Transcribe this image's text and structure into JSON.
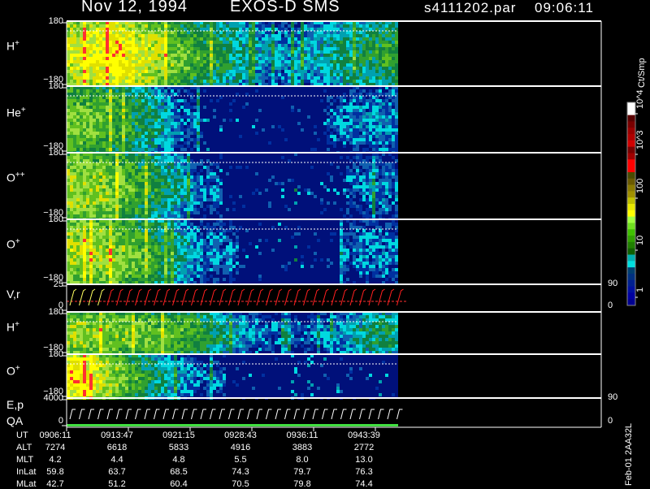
{
  "header": {
    "date": "Nov 12, 1994",
    "instrument": "EXOS-D SMS",
    "file": "s4111202.par",
    "time": "09:06:11"
  },
  "colorbar": {
    "unit": "Ct/Smp",
    "ticks": [
      "10^4",
      "10^3",
      "100",
      "10",
      "1"
    ],
    "colors": [
      "#ffffff",
      "#ffffff",
      "#5a0000",
      "#7a0000",
      "#9a0000",
      "#b00000",
      "#d00000",
      "#7a0000",
      "#a00000",
      "#ff0000",
      "#ff0000",
      "#4a4a00",
      "#6a5a00",
      "#8a7a00",
      "#a09000",
      "#c0c000",
      "#e8e800",
      "#ffff00",
      "#a0ff40",
      "#70e020",
      "#40c000",
      "#30a000",
      "#208000",
      "#106000",
      "#00b0b0",
      "#00e0e0",
      "#004070",
      "#003080",
      "#002090",
      "#0010a0",
      "#0000a0",
      "#000090"
    ]
  },
  "panels": [
    {
      "id": "h-plus",
      "label": "H",
      "sup": "+",
      "top_tick": "180",
      "bot_tick": "−180"
    },
    {
      "id": "he-plus",
      "label": "He",
      "sup": "+",
      "top_tick": "180",
      "bot_tick": "−180"
    },
    {
      "id": "o-plusplus",
      "label": "O",
      "sup": "++",
      "top_tick": "180",
      "bot_tick": "−180"
    },
    {
      "id": "o-plus",
      "label": "O",
      "sup": "+",
      "top_tick": "180",
      "bot_tick": "−180"
    },
    {
      "id": "vr",
      "label": "V,r",
      "sup": "",
      "top_tick": "25",
      "bot_tick": "0",
      "right_top": "90",
      "right_bot": "0"
    },
    {
      "id": "h-plus-2",
      "label": "H",
      "sup": "+",
      "top_tick": "180",
      "bot_tick": "−180"
    },
    {
      "id": "o-plus-2",
      "label": "O",
      "sup": "+",
      "top_tick": "180",
      "bot_tick": "−180"
    },
    {
      "id": "ep",
      "label": "E,p",
      "label2": "QA",
      "sup": "",
      "top_tick": "4000",
      "bot_tick": "0",
      "right_top": "90",
      "right_bot": "0"
    }
  ],
  "footer": {
    "rows": [
      {
        "name": "UT",
        "values": [
          "0906:11",
          "0913:47",
          "0921:15",
          "0928:43",
          "0936:11",
          "0943:39"
        ]
      },
      {
        "name": "ALT",
        "values": [
          "7274",
          "6618",
          "5833",
          "4916",
          "3883",
          "2772"
        ]
      },
      {
        "name": "MLT",
        "values": [
          "4.2",
          "4.4",
          "4.8",
          "5.5",
          "8.0",
          "13.0"
        ]
      },
      {
        "name": "InLat",
        "values": [
          "59.8",
          "63.7",
          "68.5",
          "74.3",
          "79.7",
          "76.3"
        ]
      },
      {
        "name": "MLat",
        "values": [
          "42.7",
          "51.2",
          "60.4",
          "70.5",
          "79.8",
          "74.4"
        ]
      }
    ],
    "side_note": "Feb-01 2AA32L"
  },
  "chart_data": {
    "type": "heatmap",
    "x_time_labels": [
      "0906:11",
      "0913:47",
      "0921:15",
      "0928:43",
      "0936:11",
      "0943:39"
    ],
    "panels": [
      {
        "id": "h-plus",
        "ytick_top": 180,
        "ytick_bottom": -180,
        "profile": [
          [
            0.0,
            0.62
          ],
          [
            0.08,
            0.68
          ],
          [
            0.15,
            0.74
          ],
          [
            0.25,
            0.6
          ],
          [
            0.35,
            0.46
          ],
          [
            0.45,
            0.36
          ],
          [
            0.55,
            0.22
          ],
          [
            0.65,
            0.16
          ],
          [
            0.75,
            0.22
          ],
          [
            0.85,
            0.3
          ],
          [
            0.95,
            0.38
          ],
          [
            1.0,
            0.4
          ]
        ]
      },
      {
        "id": "he-plus",
        "ytick_top": 180,
        "ytick_bottom": -180,
        "profile": [
          [
            0.0,
            0.5
          ],
          [
            0.08,
            0.48
          ],
          [
            0.15,
            0.42
          ],
          [
            0.25,
            0.3
          ],
          [
            0.35,
            0.1
          ],
          [
            0.5,
            0.04
          ],
          [
            0.7,
            0.04
          ],
          [
            0.85,
            0.12
          ],
          [
            0.95,
            0.16
          ],
          [
            1.0,
            0.14
          ]
        ]
      },
      {
        "id": "o-plusplus",
        "ytick_top": 180,
        "ytick_bottom": -180,
        "profile": [
          [
            0.0,
            0.56
          ],
          [
            0.1,
            0.54
          ],
          [
            0.2,
            0.44
          ],
          [
            0.3,
            0.3
          ],
          [
            0.4,
            0.1
          ],
          [
            0.6,
            0.04
          ],
          [
            0.8,
            0.06
          ],
          [
            0.9,
            0.12
          ],
          [
            1.0,
            0.12
          ]
        ]
      },
      {
        "id": "o-plus",
        "ytick_top": 180,
        "ytick_bottom": -180,
        "profile": [
          [
            0.0,
            0.58
          ],
          [
            0.1,
            0.56
          ],
          [
            0.2,
            0.48
          ],
          [
            0.3,
            0.34
          ],
          [
            0.4,
            0.12
          ],
          [
            0.6,
            0.05
          ],
          [
            0.8,
            0.07
          ],
          [
            0.9,
            0.12
          ],
          [
            1.0,
            0.12
          ]
        ]
      },
      {
        "id": "h-plus-2",
        "ytick_top": 180,
        "ytick_bottom": -180,
        "profile": [
          [
            0.0,
            0.56
          ],
          [
            0.1,
            0.54
          ],
          [
            0.2,
            0.5
          ],
          [
            0.3,
            0.46
          ],
          [
            0.4,
            0.4
          ],
          [
            0.5,
            0.22
          ],
          [
            0.6,
            0.1
          ],
          [
            0.75,
            0.08
          ],
          [
            0.88,
            0.26
          ],
          [
            0.95,
            0.34
          ],
          [
            1.0,
            0.28
          ]
        ]
      },
      {
        "id": "o-plus-2",
        "ytick_top": 180,
        "ytick_bottom": -180,
        "profile": [
          [
            0.0,
            0.74
          ],
          [
            0.06,
            0.7
          ],
          [
            0.12,
            0.58
          ],
          [
            0.2,
            0.44
          ],
          [
            0.3,
            0.24
          ],
          [
            0.4,
            0.1
          ],
          [
            0.6,
            0.05
          ],
          [
            0.8,
            0.05
          ],
          [
            1.0,
            0.06
          ]
        ]
      }
    ]
  }
}
